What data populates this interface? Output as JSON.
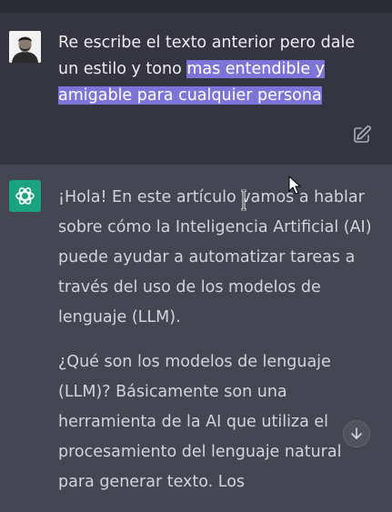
{
  "user_message": {
    "text_plain": "Re escribe el texto anterior pero dale un estilo y tono ",
    "text_highlighted": "mas entendible y amigable para cualquier persona"
  },
  "assistant_message": {
    "paragraph_1": "¡Hola! En este artículo vamos a hablar sobre cómo la Inteligencia Artificial (AI) puede ayudar a automatizar tareas a través del uso de los modelos de lenguaje (LLM).",
    "paragraph_2": "¿Qué son los modelos de lenguaje (LLM)? Básicamente son una herramienta de la AI que utiliza el procesamiento del lenguaje natural para generar texto. Los"
  },
  "icons": {
    "edit": "edit-icon",
    "assistant_logo": "openai-logo-icon",
    "scroll_down": "arrow-down-icon"
  },
  "colors": {
    "user_bg": "#343541",
    "assistant_bg": "#444654",
    "highlight": "#7c74d8",
    "assistant_avatar": "#19a37f"
  }
}
